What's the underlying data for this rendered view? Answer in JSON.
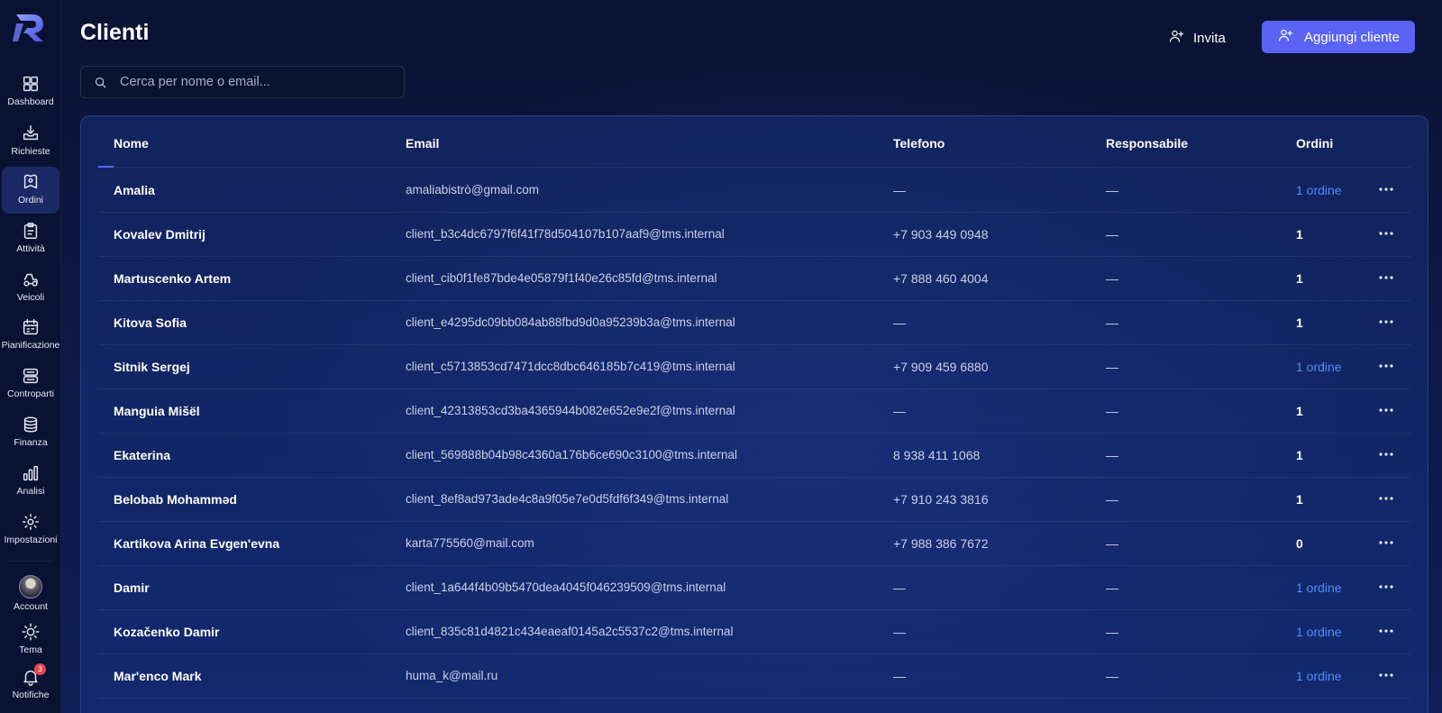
{
  "app": {
    "title": "Clienti"
  },
  "colors": {
    "accent": "#5b63f5",
    "link": "#4f8cff",
    "badge": "#e5484d"
  },
  "sidebar": {
    "items": [
      {
        "label": "Dashboard",
        "icon": "dashboard-grid-icon"
      },
      {
        "label": "Richieste",
        "icon": "inbox-download-icon"
      },
      {
        "label": "Ordini",
        "icon": "orders-pin-icon",
        "active": true
      },
      {
        "label": "Attività",
        "icon": "clipboard-icon"
      },
      {
        "label": "Veicoli",
        "icon": "truck-icon"
      },
      {
        "label": "Pianificazione",
        "icon": "calendar-icon"
      },
      {
        "label": "Controparti",
        "icon": "counterparts-icon"
      },
      {
        "label": "Finanza",
        "icon": "coins-icon"
      },
      {
        "label": "Analisi",
        "icon": "bar-chart-icon"
      },
      {
        "label": "Impostazioni",
        "icon": "gear-icon"
      }
    ],
    "bottom": [
      {
        "label": "Account",
        "icon": "avatar"
      },
      {
        "label": "Tema",
        "icon": "sun-icon"
      },
      {
        "label": "Notifiche",
        "icon": "bell-icon",
        "badge": "3"
      }
    ]
  },
  "header": {
    "invite_label": "Invita",
    "add_label": "Aggiungi cliente"
  },
  "search": {
    "placeholder": "Cerca per nome o email...",
    "value": ""
  },
  "table": {
    "columns": [
      "Nome",
      "Email",
      "Telefono",
      "Responsabile",
      "Ordini"
    ],
    "rows": [
      {
        "name": "Amalia",
        "email": "amaliabistrò@gmail.com",
        "phone": "—",
        "resp": "—",
        "orders": "1 ordine",
        "link": true
      },
      {
        "name": "Kovalev Dmitrij",
        "email": "client_b3c4dc6797f6f41f78d504107b107aaf9@tms.internal",
        "phone": "+7 903 449 0948",
        "resp": "—",
        "orders": "1",
        "link": false
      },
      {
        "name": "Martuscenko Artem",
        "email": "client_cib0f1fe87bde4e05879f1f40e26c85fd@tms.internal",
        "phone": "+7 888 460 4004",
        "resp": "—",
        "orders": "1",
        "link": false
      },
      {
        "name": "Kitova Sofia",
        "email": "client_e4295dc09bb084ab88fbd9d0a95239b3a@tms.internal",
        "phone": "—",
        "resp": "—",
        "orders": "1",
        "link": false
      },
      {
        "name": "Sitnik Sergej",
        "email": "client_c5713853cd7471dcc8dbc646185b7c419@tms.internal",
        "phone": "+7 909 459 6880",
        "resp": "—",
        "orders": "1 ordine",
        "link": true
      },
      {
        "name": "Manguia Mišël",
        "email": "client_42313853cd3ba4365944b082e652e9e2f@tms.internal",
        "phone": "—",
        "resp": "—",
        "orders": "1",
        "link": false
      },
      {
        "name": "Ekaterina",
        "email": "client_569888b04b98c4360a176b6ce690c3100@tms.internal",
        "phone": "8 938 411 1068",
        "resp": "—",
        "orders": "1",
        "link": false
      },
      {
        "name": "Belobab Mohamməd",
        "email": "client_8ef8ad973ade4c8a9f05e7e0d5fdf6f349@tms.internal",
        "phone": "+7 910 243 3816",
        "resp": "—",
        "orders": "1",
        "link": false
      },
      {
        "name": "Kartikova Arina Evgen'evna",
        "email": "karta775560@mail.com",
        "phone": "+7 988 386 7672",
        "resp": "—",
        "orders": "0",
        "link": false
      },
      {
        "name": "Damir",
        "email": "client_1a644f4b09b5470dea4045f046239509@tms.internal",
        "phone": "—",
        "resp": "—",
        "orders": "1 ordine",
        "link": true
      },
      {
        "name": "Kozačenko Damir",
        "email": "client_835c81d4821c434eaeaf0145a2c5537c2@tms.internal",
        "phone": "—",
        "resp": "—",
        "orders": "1 ordine",
        "link": true
      },
      {
        "name": "Mar'enco Mark",
        "email": "huma_k@mail.ru",
        "phone": "—",
        "resp": "—",
        "orders": "1 ordine",
        "link": true
      }
    ]
  }
}
